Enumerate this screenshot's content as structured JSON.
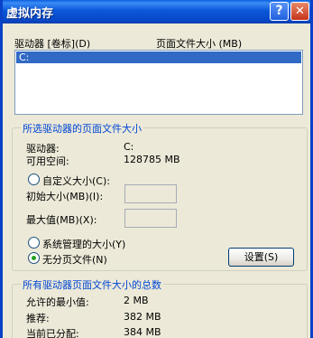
{
  "window": {
    "title": "虚拟内存"
  },
  "titlebar": {
    "help_glyph": "?",
    "close_glyph": "✕"
  },
  "drive_list": {
    "col_drive": "驱动器 [卷标](D)",
    "col_pagefile": "页面文件大小 (MB)",
    "rows": [
      {
        "drive": "C:",
        "selected": true
      }
    ]
  },
  "selected_drive": {
    "group_title": "所选驱动器的页面文件大小",
    "drive_label": "驱动器:",
    "drive_value": "C:",
    "space_label": "可用空间:",
    "space_value": "128785 MB",
    "custom_label": "自定义大小(C):",
    "initial_label": "初始大小(MB)(I):",
    "initial_value": "",
    "max_label": "最大值(MB)(X):",
    "max_value": "",
    "system_label": "系统管理的大小(Y)",
    "none_label": "无分页文件(N)",
    "selected_option": "none",
    "set_button": "设置(S)"
  },
  "totals": {
    "group_title": "所有驱动器页面文件大小的总数",
    "min_label": "允许的最小值:",
    "min_value": "2 MB",
    "rec_label": "推荐:",
    "rec_value": "382 MB",
    "current_label": "当前已分配:",
    "current_value": "384 MB"
  },
  "colors": {
    "title_blue": "#0a58d8",
    "group_title": "#0046d5",
    "selection": "#316ac5",
    "face": "#ece9d8"
  }
}
